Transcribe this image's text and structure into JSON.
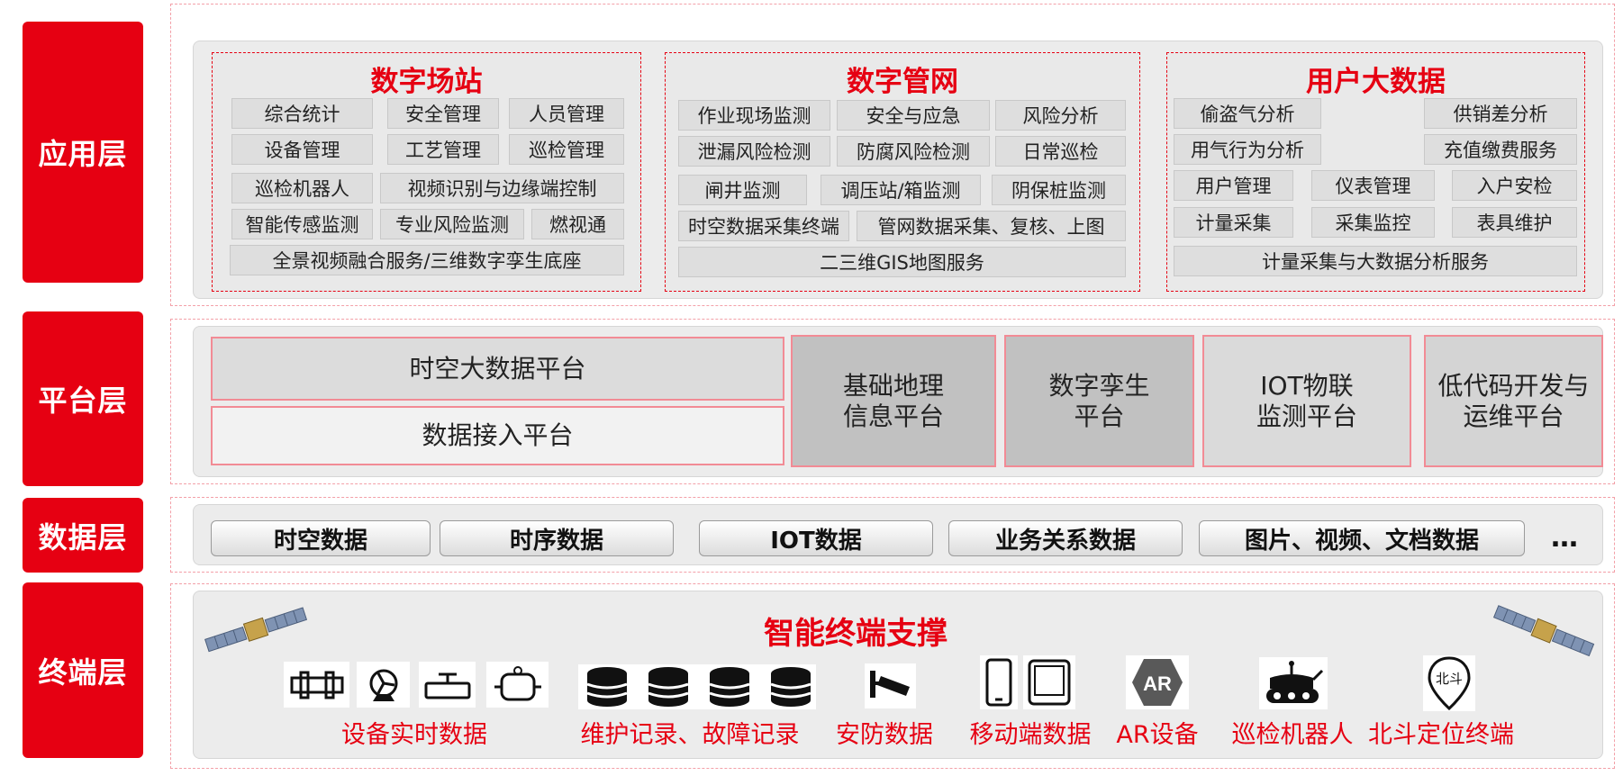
{
  "layers": {
    "app": "应用层",
    "platform": "平台层",
    "data": "数据层",
    "terminal": "终端层"
  },
  "app_layer": {
    "station": {
      "title": "数字场站",
      "items": [
        "综合统计",
        "安全管理",
        "人员管理",
        "设备管理",
        "工艺管理",
        "巡检管理",
        "巡检机器人",
        "视频识别与边缘端控制",
        "智能传感监测",
        "专业风险监测",
        "燃视通",
        "全景视频融合服务/三维数字孪生底座"
      ]
    },
    "pipenet": {
      "title": "数字管网",
      "items": [
        "作业现场监测",
        "安全与应急",
        "风险分析",
        "泄漏风险检测",
        "防腐风险检测",
        "日常巡检",
        "闸井监测",
        "调压站/箱监测",
        "阴保桩监测",
        "时空数据采集终端",
        "管网数据采集、复核、上图",
        "二三维GIS地图服务"
      ]
    },
    "user": {
      "title": "用户大数据",
      "items": [
        "偷盗气分析",
        "供销差分析",
        "用气行为分析",
        "充值缴费服务",
        "用户管理",
        "仪表管理",
        "入户安检",
        "计量采集",
        "采集监控",
        "表具维护",
        "计量采集与大数据分析服务"
      ]
    }
  },
  "platform_layer": {
    "spatial": "时空大数据平台",
    "access": "数据接入平台",
    "geo": [
      "基础地理",
      "信息平台"
    ],
    "twin": [
      "数字孪生",
      "平台"
    ],
    "iot": [
      "IOT物联",
      "监测平台"
    ],
    "lowcode": [
      "低代码开发与",
      "运维平台"
    ]
  },
  "data_layer": {
    "items": [
      "时空数据",
      "时序数据",
      "IOT数据",
      "业务关系数据",
      "图片、视频、文档数据"
    ],
    "more": "…"
  },
  "terminal_layer": {
    "title": "智能终端支撑",
    "labels": [
      "设备实时数据",
      "维护记录、故障记录",
      "安防数据",
      "移动端数据",
      "AR设备",
      "巡检机器人",
      "北斗定位终端"
    ],
    "ar_badge": "AR",
    "beidou_badge": "北斗",
    "icons": [
      "pipe-icon",
      "valve-fan-icon",
      "pipe-valve-icon",
      "meter-icon",
      "database-icon",
      "cctv-camera-icon",
      "smartphone-icon",
      "tablet-icon",
      "ar-hexagon-icon",
      "robot-icon",
      "map-pin-icon",
      "satellite-icon"
    ]
  },
  "colors": {
    "accent": "#e60012",
    "panel": "#ececec",
    "cell": "#dedede",
    "dark_cell": "#c0c0c0"
  }
}
